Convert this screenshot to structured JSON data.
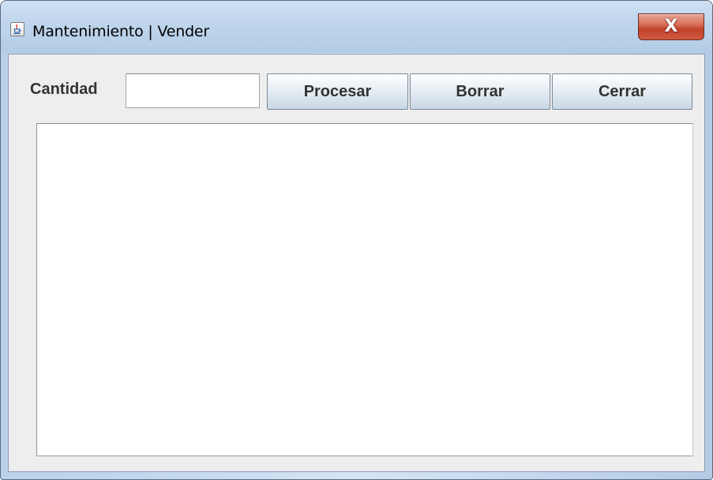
{
  "window": {
    "title": "Mantenimiento | Vender",
    "icon": "java-cup-icon",
    "close_label": "X"
  },
  "form": {
    "cantidad_label": "Cantidad",
    "cantidad_value": "",
    "output_text": ""
  },
  "buttons": {
    "procesar": "Procesar",
    "borrar": "Borrar",
    "cerrar": "Cerrar"
  },
  "colors": {
    "client_background": "#eeeeee",
    "close_button": "#c2412b",
    "titlebar": "#c7dcf0"
  }
}
